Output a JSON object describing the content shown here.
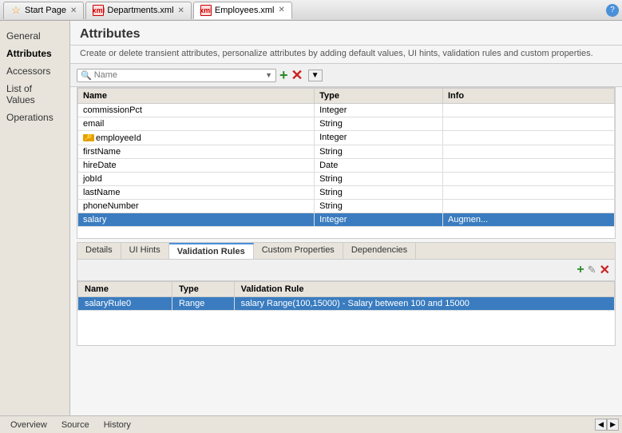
{
  "tabs": [
    {
      "id": "start",
      "label": "Start Page",
      "icon": "star",
      "active": false,
      "closable": true
    },
    {
      "id": "departments",
      "label": "Departments.xml",
      "icon": "xml",
      "active": false,
      "closable": true
    },
    {
      "id": "employees",
      "label": "Employees.xml",
      "icon": "xml",
      "active": true,
      "closable": true
    }
  ],
  "help_btn": "?",
  "sidebar": {
    "items": [
      {
        "id": "general",
        "label": "General",
        "active": false
      },
      {
        "id": "attributes",
        "label": "Attributes",
        "active": true
      },
      {
        "id": "accessors",
        "label": "Accessors",
        "active": false
      },
      {
        "id": "list-of-values",
        "label": "List of Values",
        "active": false
      },
      {
        "id": "operations",
        "label": "Operations",
        "active": false
      }
    ]
  },
  "attributes_section": {
    "title": "Attributes",
    "description": "Create or delete transient attributes, personalize attributes by adding default values, UI hints, validation rules and custom properties.",
    "search_placeholder": "Name",
    "toolbar": {
      "add_btn": "+",
      "remove_btn": "✕"
    },
    "table": {
      "columns": [
        "Name",
        "Type",
        "Info"
      ],
      "rows": [
        {
          "name": "commissionPct",
          "type": "Integer",
          "info": "",
          "key": false,
          "selected": false
        },
        {
          "name": "email",
          "type": "String",
          "info": "",
          "key": false,
          "selected": false
        },
        {
          "name": "employeeId",
          "type": "Integer",
          "info": "",
          "key": true,
          "selected": false
        },
        {
          "name": "firstName",
          "type": "String",
          "info": "",
          "key": false,
          "selected": false
        },
        {
          "name": "hireDate",
          "type": "Date",
          "info": "",
          "key": false,
          "selected": false
        },
        {
          "name": "jobId",
          "type": "String",
          "info": "",
          "key": false,
          "selected": false
        },
        {
          "name": "lastName",
          "type": "String",
          "info": "",
          "key": false,
          "selected": false
        },
        {
          "name": "phoneNumber",
          "type": "String",
          "info": "",
          "key": false,
          "selected": false
        },
        {
          "name": "salary",
          "type": "Integer",
          "info": "Augmen...",
          "key": false,
          "selected": true
        }
      ]
    }
  },
  "bottom_panel": {
    "tabs": [
      {
        "id": "details",
        "label": "Details",
        "active": false
      },
      {
        "id": "ui-hints",
        "label": "UI Hints",
        "active": false
      },
      {
        "id": "validation-rules",
        "label": "Validation Rules",
        "active": true
      },
      {
        "id": "custom-properties",
        "label": "Custom Properties",
        "active": false
      },
      {
        "id": "dependencies",
        "label": "Dependencies",
        "active": false
      }
    ],
    "validation_rules": {
      "toolbar": {
        "add_btn": "+",
        "edit_btn": "✎",
        "remove_btn": "✕"
      },
      "table": {
        "columns": [
          "Name",
          "Type",
          "Validation Rule"
        ],
        "rows": [
          {
            "name": "salaryRule0",
            "type": "Range",
            "rule": "salary Range(100,15000) - Salary between 100 and 15000",
            "selected": true
          }
        ]
      }
    }
  },
  "status_bar": {
    "tabs": [
      {
        "id": "overview",
        "label": "Overview"
      },
      {
        "id": "source",
        "label": "Source"
      },
      {
        "id": "history",
        "label": "History"
      }
    ]
  }
}
